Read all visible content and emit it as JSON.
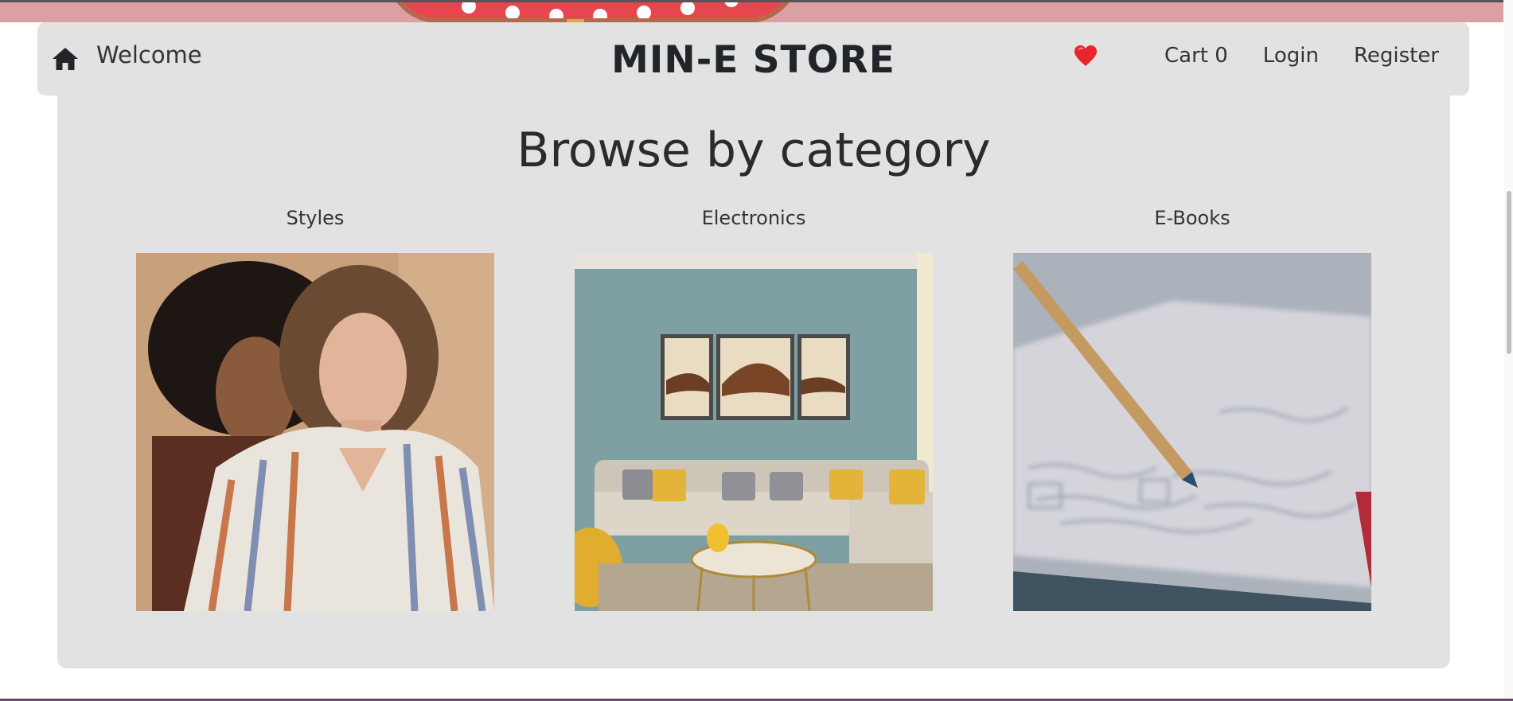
{
  "navbar": {
    "home_icon": "home-icon",
    "welcome_label": "Welcome",
    "brand": "MIN-E STORE",
    "wishlist_icon": "heart-icon",
    "cart_label": "Cart 0",
    "login_label": "Login",
    "register_label": "Register"
  },
  "categories_section": {
    "title": "Browse by category",
    "items": [
      {
        "label": "Styles",
        "image": "two women in fashion clothing"
      },
      {
        "label": "Electronics",
        "image": "living room with sofa and wall art"
      },
      {
        "label": "E-Books",
        "image": "pencil on handwritten notebook"
      }
    ]
  },
  "colors": {
    "navbar_bg": "#e2e2e2",
    "panel_bg": "#e2e2e2",
    "heart": "#e8242e",
    "hero_strip": "#dba0a4"
  }
}
